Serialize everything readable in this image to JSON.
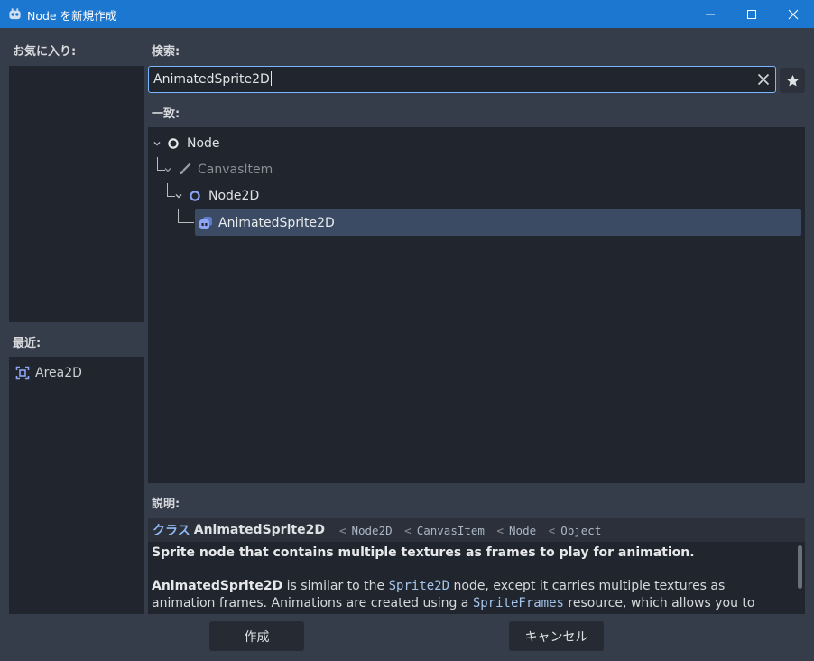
{
  "window": {
    "title": "Node を新規作成",
    "accent": "#1b77d0"
  },
  "favorites": {
    "label": "お気に入り:"
  },
  "recent": {
    "label": "最近:",
    "items": [
      {
        "label": "Area2D",
        "icon": "area2d-icon"
      }
    ]
  },
  "search": {
    "label": "検索:",
    "value": "AnimatedSprite2D",
    "clear_icon": "close-icon",
    "favorite_icon": "star-icon"
  },
  "matches": {
    "label": "一致:",
    "tree": [
      {
        "label": "Node",
        "icon": "node-icon",
        "level": 0,
        "dimmed": false,
        "selected": false
      },
      {
        "label": "CanvasItem",
        "icon": "canvasitem-icon",
        "level": 1,
        "dimmed": true,
        "selected": false
      },
      {
        "label": "Node2D",
        "icon": "node2d-icon",
        "level": 2,
        "dimmed": false,
        "selected": false
      },
      {
        "label": "AnimatedSprite2D",
        "icon": "animatedsprite2d-icon",
        "level": 3,
        "dimmed": false,
        "selected": true
      }
    ]
  },
  "description": {
    "label": "説明:",
    "class_keyword": "クラス",
    "class_name": "AnimatedSprite2D",
    "inheritance": [
      "Node2D",
      "CanvasItem",
      "Node",
      "Object"
    ],
    "separator": "<",
    "summary": "Sprite node that contains multiple textures as frames to play for animation.",
    "body": {
      "part1": "AnimatedSprite2D",
      "part2": " is similar to the ",
      "part3": "Sprite2D",
      "part4": " node, except it carries multiple textures as animation frames. Animations are created using a ",
      "part5": "SpriteFrames",
      "part6": " resource, which allows you to import image files"
    }
  },
  "buttons": {
    "create": "作成",
    "cancel": "キャンセル"
  }
}
